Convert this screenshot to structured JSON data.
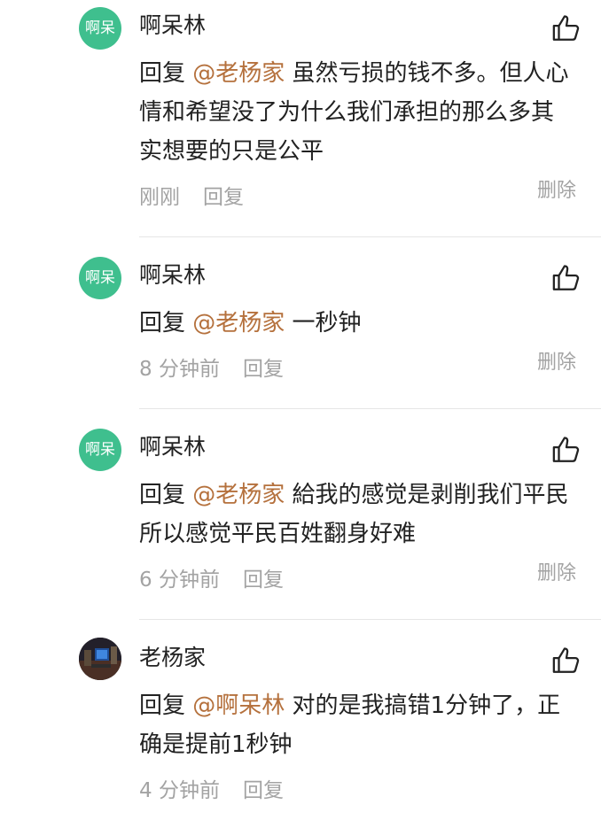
{
  "comments": [
    {
      "avatar_text": "啊呆",
      "username": "啊呆林",
      "reply_prefix": "回复 ",
      "mention": "@老杨家",
      "text": " 虽然亏损的钱不多。但人心情和希望没了为什么我们承担的那么多其实想要的只是公平",
      "time": "刚刚",
      "reply_label": "回复",
      "delete_label": "删除"
    },
    {
      "avatar_text": "啊呆",
      "username": "啊呆林",
      "reply_prefix": "回复 ",
      "mention": "@老杨家",
      "text": " 一秒钟",
      "time": "8 分钟前",
      "reply_label": "回复",
      "delete_label": "删除"
    },
    {
      "avatar_text": "啊呆",
      "username": "啊呆林",
      "reply_prefix": "回复 ",
      "mention": "@老杨家",
      "text": " 給我的感觉是剥削我们平民所以感觉平民百姓翻身好难",
      "time": "6 分钟前",
      "reply_label": "回复",
      "delete_label": "删除"
    },
    {
      "username": "老杨家",
      "reply_prefix": "回复 ",
      "mention": "@啊呆林",
      "text": " 对的是我搞错1分钟了，正确是提前1秒钟",
      "time": "4 分钟前",
      "reply_label": "回复"
    }
  ],
  "icons": {
    "like": "thumbs-up-outline-icon"
  },
  "colors": {
    "avatar_green": "#3fbf8e",
    "mention": "#b5713d",
    "meta_gray": "#a3a3a3"
  }
}
